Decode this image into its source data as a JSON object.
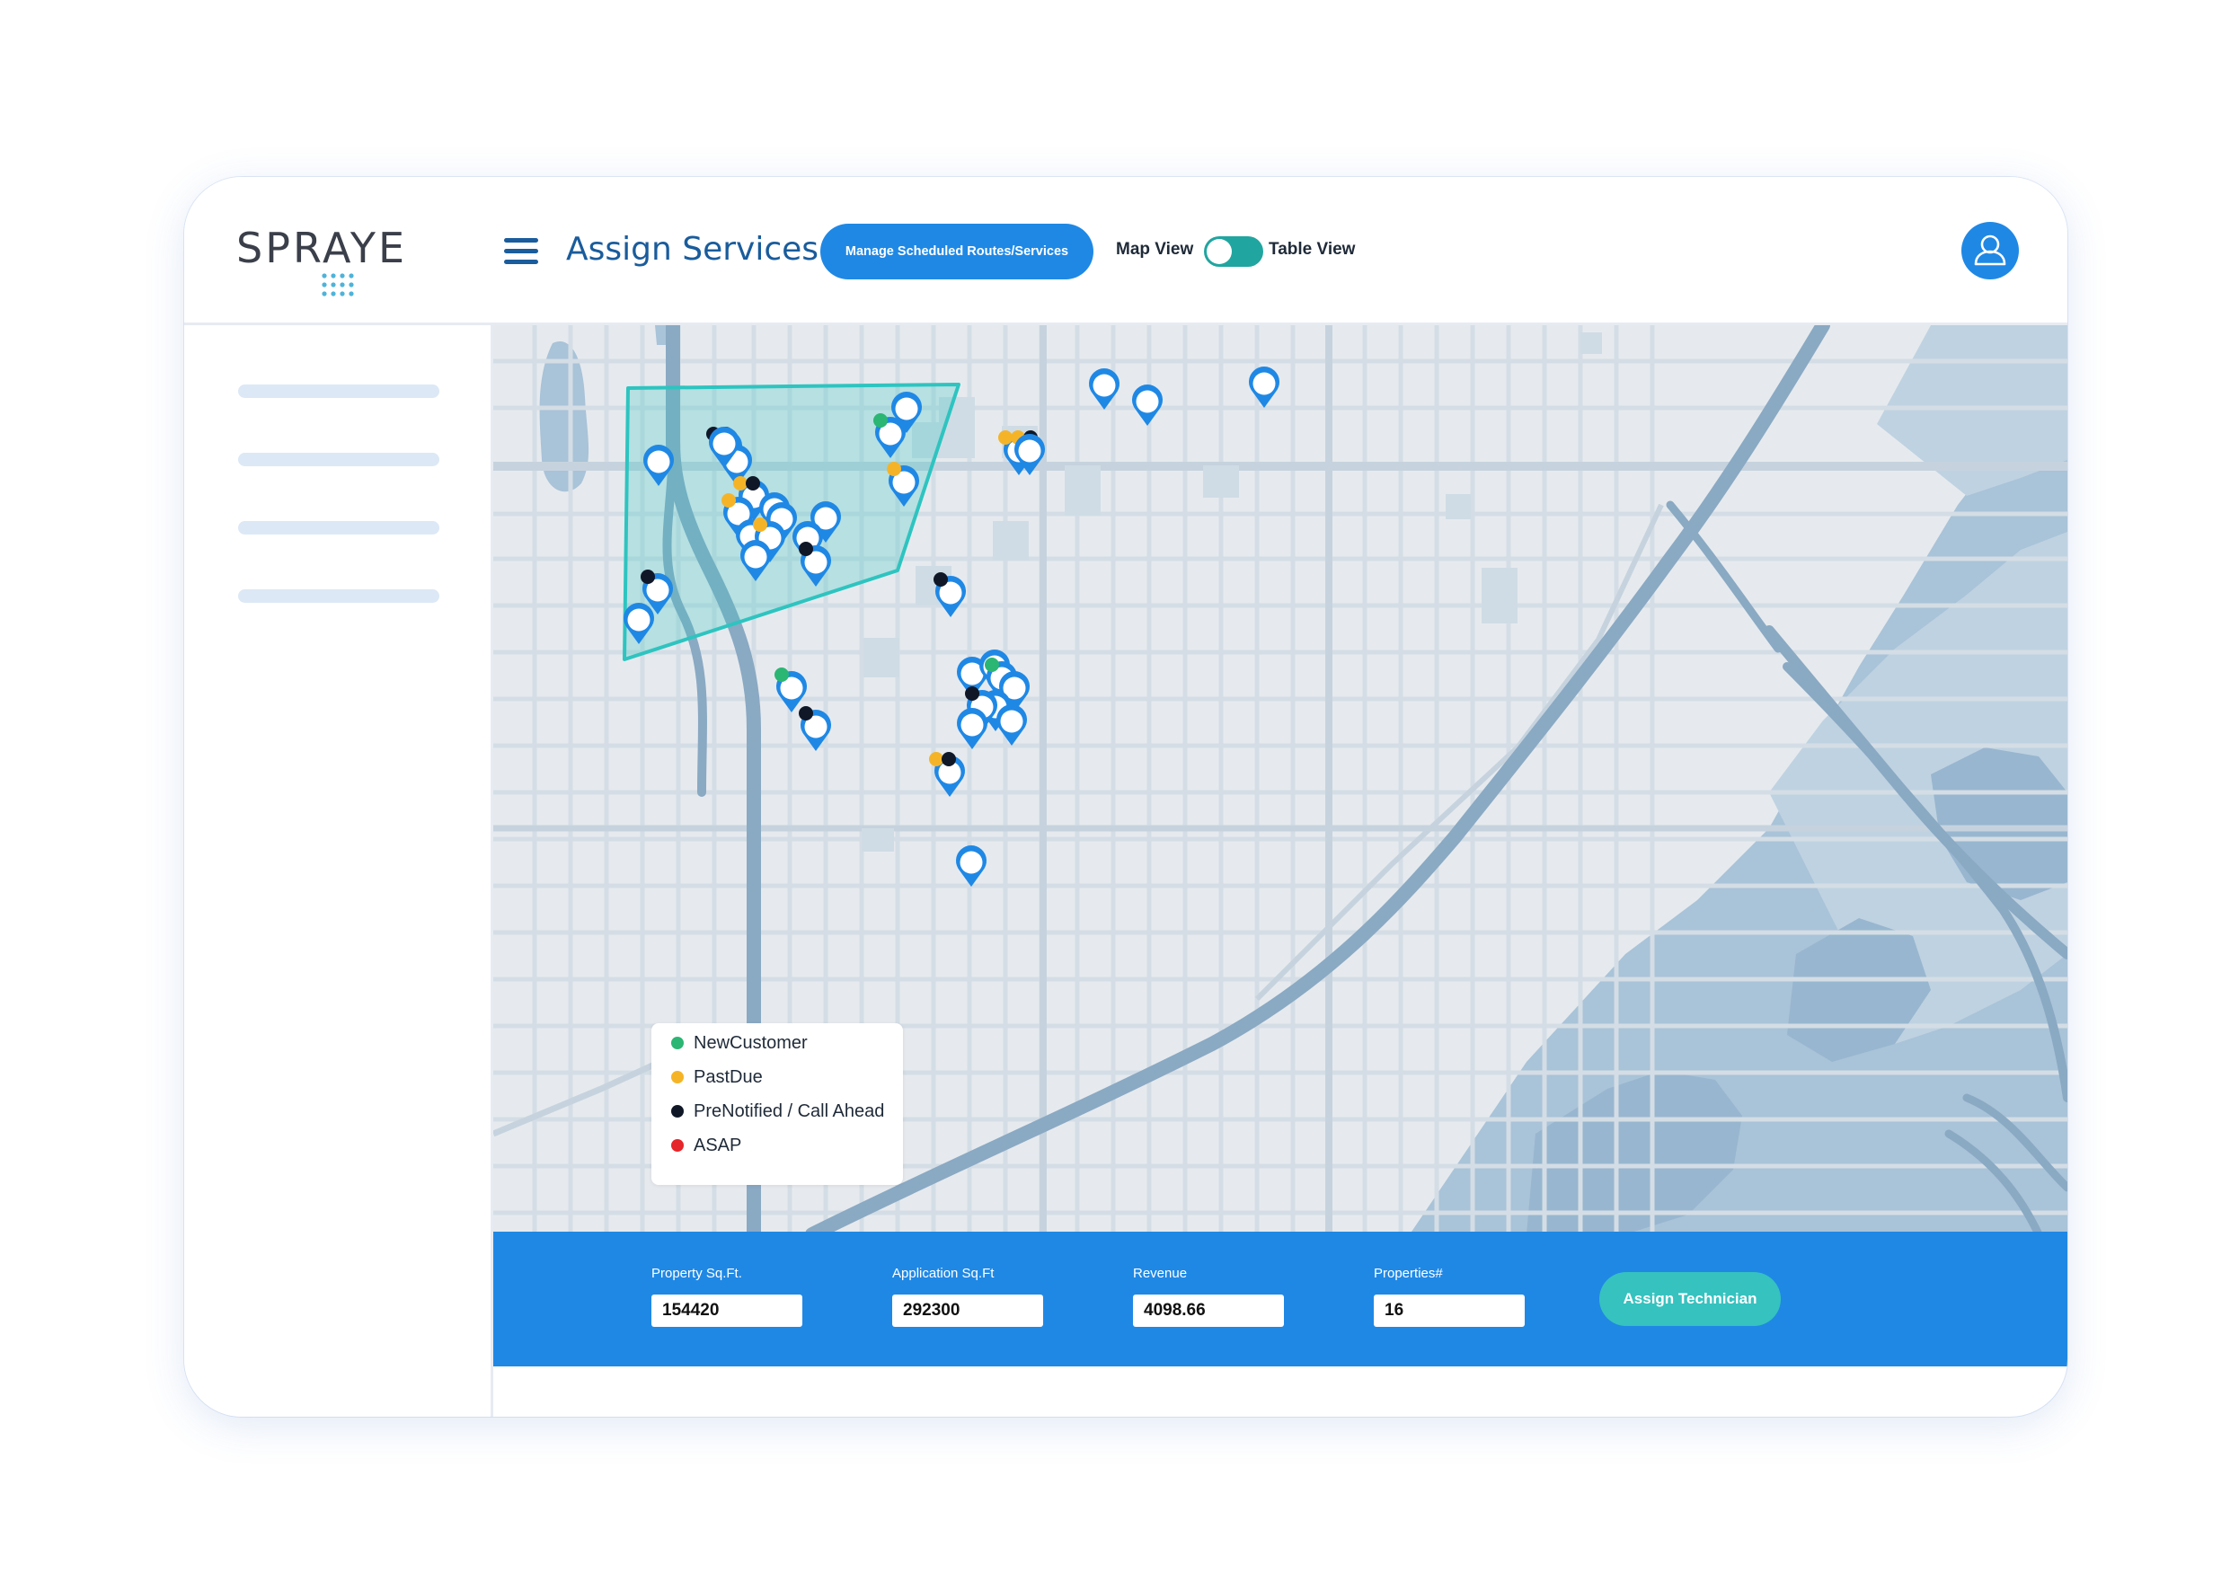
{
  "brand": {
    "logo_text": "SPRAYE",
    "logo_dots_color": "#4fb3d9"
  },
  "header": {
    "title": "Assign Services",
    "manage_button": "Manage Scheduled Routes/Services",
    "map_view_label": "Map View",
    "table_view_label": "Table View",
    "view_toggle": {
      "active": "Map View"
    },
    "accent_color": "#1f88e5",
    "title_color": "#1a5c9c"
  },
  "sidebar": {
    "item_count": 4
  },
  "legend": {
    "items": [
      {
        "label": "NewCustomer",
        "color": "#2bb673"
      },
      {
        "label": "PastDue",
        "color": "#f5b428"
      },
      {
        "label": "PreNotified / Call Ahead",
        "color": "#101828"
      },
      {
        "label": "ASAP",
        "color": "#e5262a"
      }
    ]
  },
  "map": {
    "selection_polygon_color": "#2ec4c0",
    "marker_color": "#1f88e5",
    "water_color": "#a7c1d6",
    "highway_color": "#8aa9c3"
  },
  "bottom_bar": {
    "fields": [
      {
        "label": "Property Sq.Ft.",
        "value": "154420"
      },
      {
        "label": "Application Sq.Ft",
        "value": "292300"
      },
      {
        "label": "Revenue",
        "value": "4098.66"
      },
      {
        "label": "Properties#",
        "value": "16"
      }
    ],
    "assign_button": "Assign Technician",
    "assign_button_color": "#36c2bf"
  }
}
